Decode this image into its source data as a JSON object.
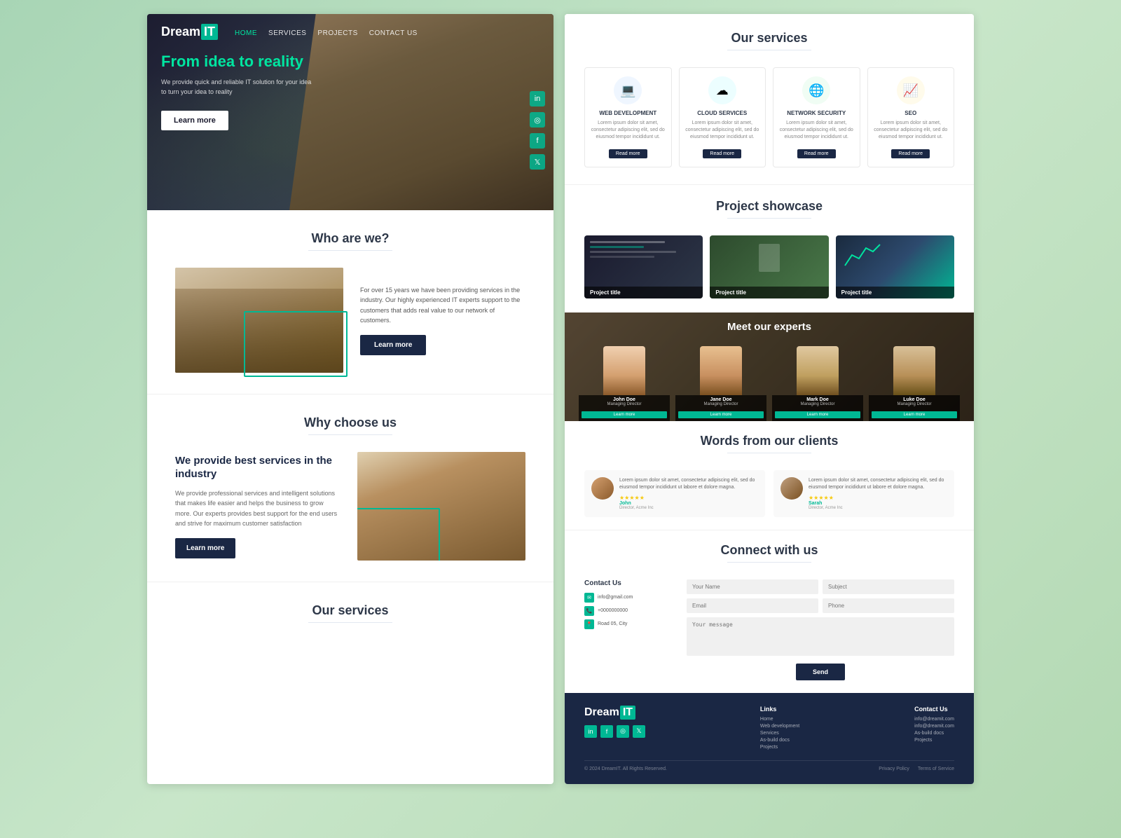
{
  "brand": {
    "name_dream": "Dream",
    "name_it": "IT",
    "tagline": "From idea to reality"
  },
  "nav": {
    "links": [
      "HOME",
      "SERVICES",
      "PROJECTS",
      "CONTACT US"
    ]
  },
  "hero": {
    "title": "From idea to reality",
    "subtitle": "We provide quick and reliable IT solution for your idea to turn your idea to reality",
    "cta": "Learn more",
    "social": [
      "in",
      "◎",
      "f",
      "🐦"
    ]
  },
  "who_are_we": {
    "title": "Who are we?",
    "body": "For over 15 years we have been providing services in the industry. Our highly experienced IT experts support to the customers that adds real value to our network of customers.",
    "cta": "Learn more"
  },
  "why_choose_us": {
    "title": "Why choose us",
    "heading": "We provide best services in the industry",
    "body": "We provide professional services and intelligent solutions that makes life easier and helps the business to grow more. Our experts provides best support for the end users and strive for maximum customer satisfaction",
    "cta": "Learn more"
  },
  "our_services_bottom": {
    "title": "Our services"
  },
  "our_services_right": {
    "title": "Our services",
    "services": [
      {
        "name": "WEB DEVELOPMENT",
        "icon": "💻",
        "color": "#3b82f6",
        "desc": "Lorem ipsum dolor sit amet, consectetur adipiscing elit, sed do eiusmod tempor incididunt ut.",
        "btn": "Read more"
      },
      {
        "name": "CLOUD SERVICES",
        "icon": "☁",
        "color": "#06b6d4",
        "desc": "Lorem ipsum dolor sit amet, consectetur adipiscing elit, sed do eiusmod tempor incididunt ut.",
        "btn": "Read more"
      },
      {
        "name": "NETWORK SECURITY",
        "icon": "🌐",
        "color": "#22c55e",
        "desc": "Lorem ipsum dolor sit amet, consectetur adipiscing elit, sed do eiusmod tempor incididunt ut.",
        "btn": "Read more"
      },
      {
        "name": "SEO",
        "icon": "📈",
        "color": "#f59e0b",
        "desc": "Lorem ipsum dolor sit amet, consectetur adipiscing elit, sed do eiusmod tempor incididunt ut.",
        "btn": "Read more"
      }
    ]
  },
  "project_showcase": {
    "title": "Project showcase",
    "projects": [
      {
        "label": "Project title"
      },
      {
        "label": "Project title"
      },
      {
        "label": "Project title"
      }
    ]
  },
  "meet_experts": {
    "title": "Meet our experts",
    "experts": [
      {
        "name": "John Doe",
        "role": "Managing Director",
        "btn": "Learn more"
      },
      {
        "name": "Jane Doe",
        "role": "Managing Director",
        "btn": "Learn more"
      },
      {
        "name": "Mark Doe",
        "role": "Managing Director",
        "btn": "Learn more"
      },
      {
        "name": "Luke Doe",
        "role": "Managing Director",
        "btn": "Learn more"
      }
    ]
  },
  "words_clients": {
    "title": "Words from our clients",
    "testimonials": [
      {
        "text": "Lorem ipsum dolor sit amet, consectetur adipiscing elit, sed do eiusmod tempor incididunt ut labore et dolore magna.",
        "name": "John",
        "role": "Director, Acme Inc",
        "stars": "★★★★★"
      },
      {
        "text": "Lorem ipsum dolor sit amet, consectetur adipiscing elit, sed do eiusmod tempor incididunt ut labore et dolore magna.",
        "name": "Sarah",
        "role": "Director, Acme Inc",
        "stars": "★★★★★"
      }
    ]
  },
  "connect": {
    "title": "Connect with us",
    "contact_title": "Contact Us",
    "email": "info@gmail.com",
    "phone": "+0000000000",
    "address": "Road 05, City",
    "form": {
      "name_placeholder": "Your Name",
      "subject_placeholder": "Subject",
      "email_placeholder": "Email",
      "phone_placeholder": "Phone",
      "message_placeholder": "Your message",
      "send_btn": "Send"
    }
  },
  "footer": {
    "brand_dream": "Dream",
    "brand_it": "IT",
    "links_title": "Links",
    "links": [
      "Home",
      "Web development",
      "Services",
      "As-build docs",
      "Projects"
    ],
    "contact_title": "Contact Us",
    "contacts": [
      "info@dreamit.com",
      "info@dreamit.com",
      "As-build docs",
      "Projects"
    ],
    "copyright": "© 2024 DreamIT. All Rights Reserved.",
    "privacy": "Privacy Policy",
    "terms": "Terms of Service"
  },
  "colors": {
    "accent": "#00b894",
    "dark_nav": "#1a2744",
    "text_dark": "#2d3748"
  }
}
